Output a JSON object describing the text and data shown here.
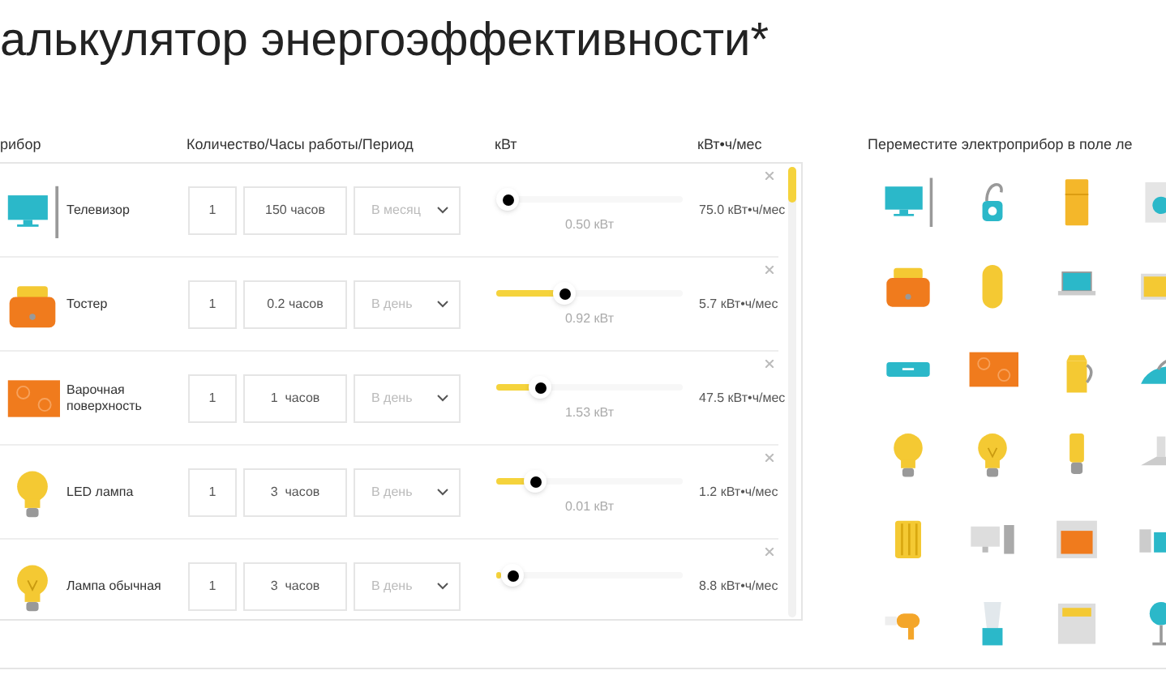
{
  "title": "алькулятор энергоэффективности*",
  "columns": [
    "рибор",
    "Количество/Часы работы/Период",
    "кВт",
    "кВт•ч/мес"
  ],
  "rows": [
    {
      "kind": "tv",
      "name": "Телевизор",
      "quantity": "1",
      "hours": "150 часов",
      "period": "В месяц",
      "power": "0.50 кВт",
      "monthly": "75.0 кВт•ч/мес"
    },
    {
      "kind": "toaster",
      "name": "Тостер",
      "quantity": "1",
      "hours": "0.2 часов",
      "period": "В день",
      "level": 0.35,
      "power": "0.92 кВт",
      "monthly": "5.7 кВт•ч/мес"
    },
    {
      "kind": "hob",
      "name": "Варочная поверхность",
      "quantity": "1",
      "hours": "1  часов",
      "period": "В день",
      "level": 0.2,
      "power": "1.53 кВт",
      "monthly": "47.5 кВт•ч/мес"
    },
    {
      "kind": "led",
      "name": "LED лампа",
      "quantity": "1",
      "hours": "3  часов",
      "period": "В день",
      "level": 0.17,
      "power": "0.01 кВт",
      "monthly": "1.2 кВт•ч/мес"
    },
    {
      "kind": "bulb",
      "name": "Лампа обычная",
      "quantity": "1",
      "hours": "3  часов",
      "period": "В день",
      "level": 0.03,
      "monthly": "8.8 кВт•ч/мес"
    }
  ],
  "palette": {
    "hint": "Переместите электроприбор в поле ле"
  }
}
